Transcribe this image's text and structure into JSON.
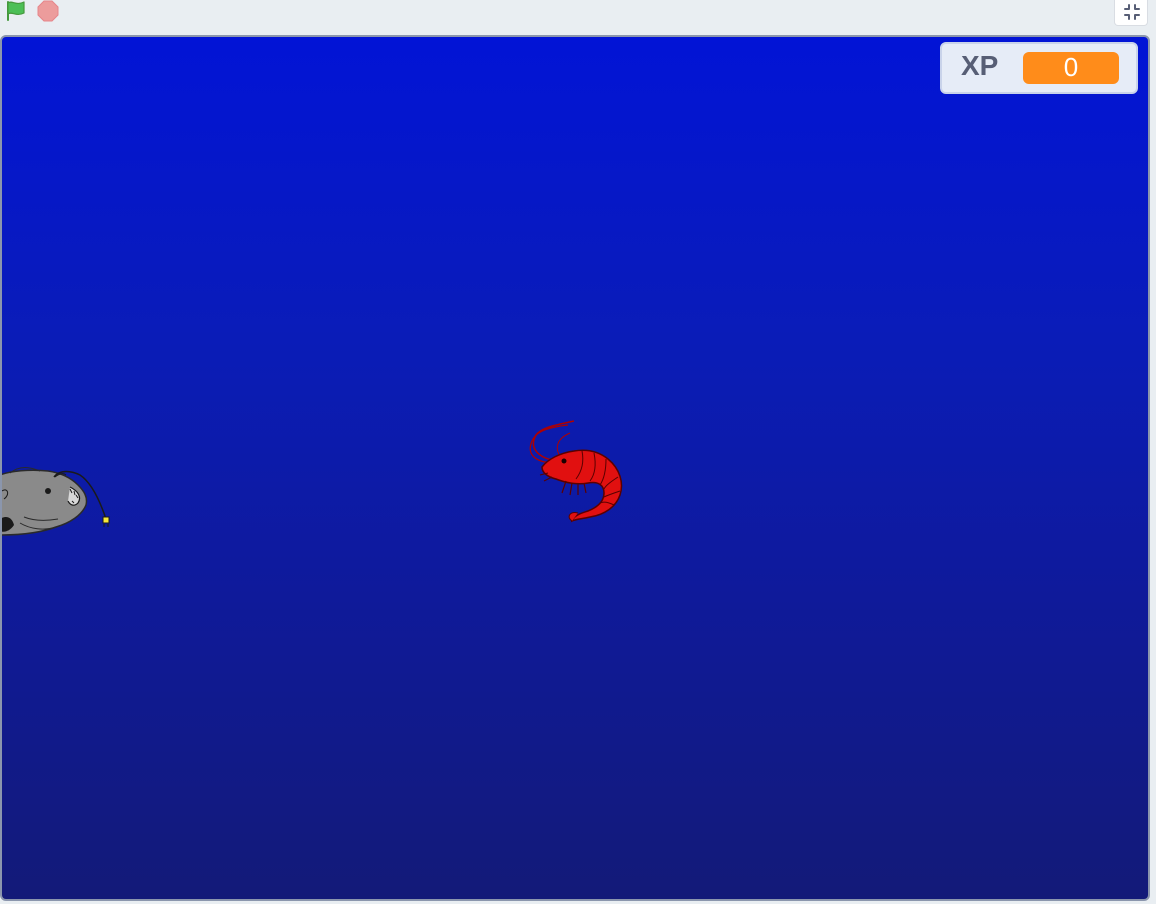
{
  "toolbar": {
    "green_flag_icon": "green-flag-icon",
    "stop_icon": "stop-sign-icon",
    "fullscreen_icon": "exit-fullscreen-icon"
  },
  "stage": {
    "background_top_color": "#0214d6",
    "background_bottom_color": "#131a78",
    "sprites": [
      "anglerfish",
      "shrimp"
    ]
  },
  "monitor": {
    "label": "XP",
    "value": "0",
    "value_color": "#ff8c1a"
  }
}
